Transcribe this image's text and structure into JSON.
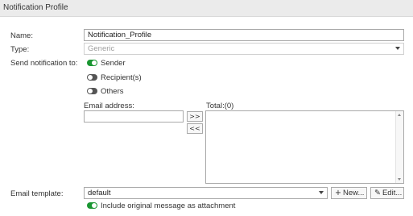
{
  "header": {
    "title": "Notification Profile"
  },
  "form": {
    "name_label": "Name:",
    "name_value": "Notification_Profile",
    "type_label": "Type:",
    "type_value": "Generic",
    "send_label": "Send notification to:",
    "recipients": [
      {
        "label": "Sender",
        "enabled": true
      },
      {
        "label": "Recipient(s)",
        "enabled": false
      },
      {
        "label": "Others",
        "enabled": false
      }
    ],
    "email_address_label": "Email address:",
    "email_address_value": "",
    "add_button": ">>",
    "remove_button": "<<",
    "total_label": "Total:(0)",
    "template_label": "Email template:",
    "template_value": "default",
    "new_button": "New...",
    "edit_button": "Edit...",
    "attach_original": {
      "label": "Include original message as attachment",
      "enabled": true
    }
  },
  "colors": {
    "toggle_on": "#1a9632",
    "toggle_off": "#555555",
    "header_bg": "#ebebeb"
  }
}
